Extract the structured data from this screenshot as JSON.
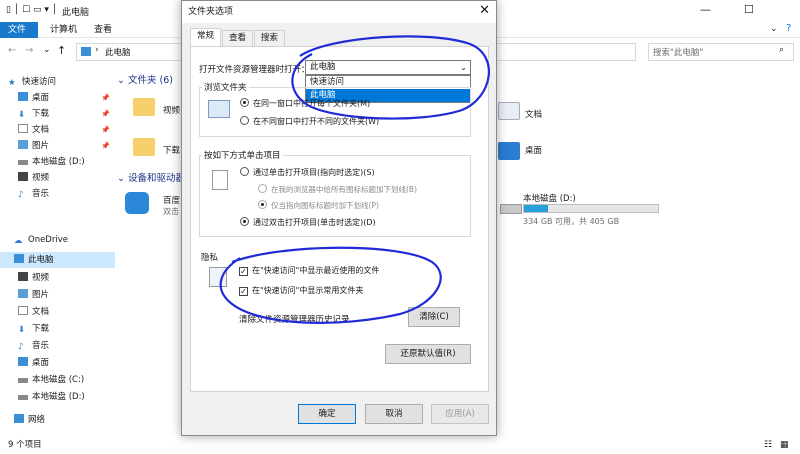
{
  "explorer": {
    "title": "此电脑",
    "ribbon_tabs": [
      "文件",
      "计算机",
      "查看"
    ],
    "address_path": "此电脑",
    "search_placeholder": "搜索\"此电脑\"",
    "section_folders": "文件夹 (6)",
    "section_devices": "设备和驱动器",
    "folders": [
      {
        "name": "视频"
      },
      {
        "name": "下载"
      },
      {
        "name": "文档"
      },
      {
        "name": "桌面"
      }
    ],
    "baidu": {
      "name": "百度",
      "sub": "双击"
    },
    "drive": {
      "name": "本地磁盘 (D:)",
      "detail": "334 GB 可用，共 405 GB",
      "used_fraction": 0.18
    },
    "status": "9 个项目",
    "sidebar": {
      "quick_access": "快速访问",
      "quick_items": [
        "桌面",
        "下载",
        "文档",
        "图片",
        "本地磁盘 (D:)",
        "视频",
        "音乐"
      ],
      "onedrive": "OneDrive",
      "this_pc": "此电脑",
      "pc_items": [
        "视频",
        "图片",
        "文档",
        "下载",
        "音乐",
        "桌面",
        "本地磁盘 (C:)",
        "本地磁盘 (D:)"
      ],
      "network": "网络"
    }
  },
  "dialog": {
    "title": "文件夹选项",
    "tabs": [
      "常规",
      "查看",
      "搜索"
    ],
    "open_label": "打开文件资源管理器时打开：",
    "select_value": "此电脑",
    "dropdown_options": [
      "快速访问",
      "此电脑"
    ],
    "browse_group": "浏览文件夹",
    "browse_options": [
      "在同一窗口中打开每个文件夹(M)",
      "在不同窗口中打开不同的文件夹(W)"
    ],
    "click_group": "按如下方式单击项目",
    "click_options": [
      "通过单击打开项目(指向时选定)(S)",
      "在我的浏览器中给所有图标标题加下划线(B)",
      "仅当指向图标标题时加下划线(P)",
      "通过双击打开项目(单击时选定)(D)"
    ],
    "privacy_group": "隐私",
    "privacy_options": [
      "在\"快速访问\"中显示最近使用的文件",
      "在\"快速访问\"中显示常用文件夹"
    ],
    "clear_label": "清除文件资源管理器历史记录",
    "clear_button": "清除(C)",
    "restore_button": "还原默认值(R)",
    "ok_button": "确定",
    "cancel_button": "取消",
    "apply_button": "应用(A)"
  },
  "colors": {
    "accent": "#0078d7",
    "annotation": "#1f2bd6",
    "ribbon_file": "#1979ca"
  }
}
